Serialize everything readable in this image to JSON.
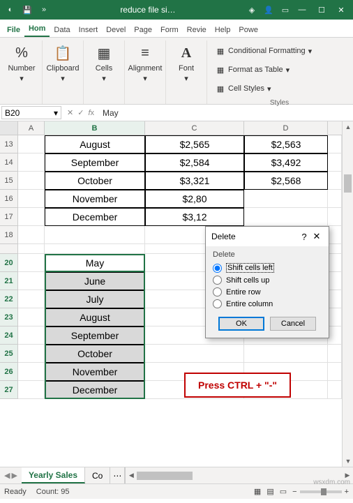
{
  "title": "reduce file si…",
  "tabs": {
    "file": "File",
    "home": "Hom",
    "data": "Data",
    "insert": "Insert",
    "devel": "Devel",
    "page": "Page",
    "form": "Form",
    "revie": "Revie",
    "help": "Help",
    "powe": "Powe"
  },
  "ribbon": {
    "number": "Number",
    "clipboard": "Clipboard",
    "cells": "Cells",
    "alignment": "Alignment",
    "font": "Font",
    "cond_fmt": "Conditional Formatting",
    "as_table": "Format as Table",
    "cell_styles": "Cell Styles",
    "styles": "Styles"
  },
  "namebox": "B20",
  "formula": "May",
  "cols": [
    "A",
    "B",
    "C",
    "D"
  ],
  "rows1": [
    "13",
    "14",
    "15",
    "16",
    "17",
    "18"
  ],
  "data1": [
    {
      "b": "August",
      "c": "$2,565",
      "d": "$2,563"
    },
    {
      "b": "September",
      "c": "$2,584",
      "d": "$3,492"
    },
    {
      "b": "October",
      "c": "$3,321",
      "d": "$2,568"
    },
    {
      "b": "November",
      "c": "$2,80",
      "d": ""
    },
    {
      "b": "December",
      "c": "$3,12",
      "d": ""
    }
  ],
  "rows2": [
    "20",
    "21",
    "22",
    "23",
    "24",
    "25",
    "26",
    "27"
  ],
  "data2": [
    "May",
    "June",
    "July",
    "August",
    "September",
    "October",
    "November",
    "December"
  ],
  "dialog": {
    "title": "Delete",
    "legend": "Delete",
    "opt1": "Shift cells left",
    "opt2": "Shift cells up",
    "opt3": "Entire row",
    "opt4": "Entire column",
    "ok": "OK",
    "cancel": "Cancel"
  },
  "callout": "Press CTRL + \"-\"",
  "sheet_active": "Yearly Sales",
  "sheet2": "Co",
  "status": {
    "mode": "Ready",
    "count": "Count: 95"
  },
  "watermark": "wsxdm.com"
}
